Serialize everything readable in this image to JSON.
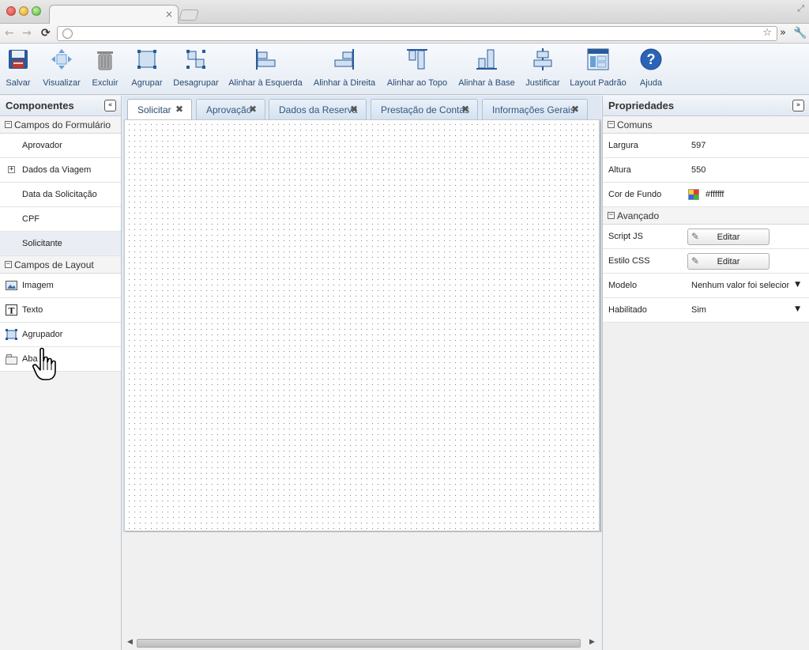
{
  "toolbar": {
    "buttons": [
      {
        "label": "Salvar",
        "icon": "floppy-disk-icon"
      },
      {
        "label": "Visualizar",
        "icon": "move-arrows-icon"
      },
      {
        "label": "Excluir",
        "icon": "trash-icon"
      },
      {
        "label": "Agrupar",
        "icon": "group-icon"
      },
      {
        "label": "Desagrupar",
        "icon": "ungroup-icon"
      },
      {
        "label": "Alinhar à Esquerda",
        "icon": "align-left-icon"
      },
      {
        "label": "Alinhar à Direita",
        "icon": "align-right-icon"
      },
      {
        "label": "Alinhar ao Topo",
        "icon": "align-top-icon"
      },
      {
        "label": "Alinhar à Base",
        "icon": "align-bottom-icon"
      },
      {
        "label": "Justificar",
        "icon": "justify-icon"
      },
      {
        "label": "Layout Padrão",
        "icon": "default-layout-icon"
      },
      {
        "label": "Ajuda",
        "icon": "help-icon"
      }
    ]
  },
  "components": {
    "title": "Componentes",
    "form_fields": {
      "title": "Campos do Formulário",
      "items": [
        "Aprovador",
        "Dados da Viagem",
        "Data da Solicitação",
        "CPF",
        "Solicitante"
      ]
    },
    "layout_fields": {
      "title": "Campos de Layout",
      "items": [
        "Imagem",
        "Texto",
        "Agrupador",
        "Aba"
      ]
    }
  },
  "form_tabs": [
    "Solicitar",
    "Aprovação",
    "Dados da Reserva",
    "Prestação de Contas",
    "Informações Gerais"
  ],
  "properties": {
    "title": "Propriedades",
    "common": {
      "title": "Comuns",
      "largura_label": "Largura",
      "largura_value": "597",
      "altura_label": "Altura",
      "altura_value": "550",
      "cor_label": "Cor de Fundo",
      "cor_value": "#ffffff"
    },
    "advanced": {
      "title": "Avançado",
      "script_label": "Script JS",
      "script_button": "Editar",
      "css_label": "Estilo CSS",
      "css_button": "Editar",
      "modelo_label": "Modelo",
      "modelo_value": "Nenhum valor foi selecionado",
      "habilitado_label": "Habilitado",
      "habilitado_value": "Sim"
    }
  },
  "colors": {
    "accent_text": "#2b4a73",
    "canvas_bg": "#ffffff"
  }
}
